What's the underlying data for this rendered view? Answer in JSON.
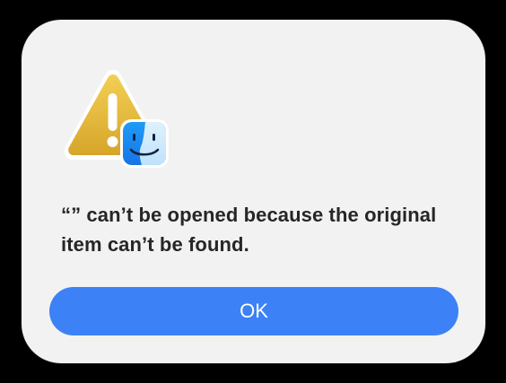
{
  "dialog": {
    "message": "“” can’t be opened because the original item can’t be found.",
    "ok_label": "OK",
    "icons": {
      "warning": "warning-triangle-icon",
      "app": "finder-icon"
    }
  },
  "colors": {
    "background": "#000000",
    "dialog": "#f2f2f2",
    "button": "#3c82f6",
    "text": "#262626",
    "warning": "#e7b83a"
  }
}
